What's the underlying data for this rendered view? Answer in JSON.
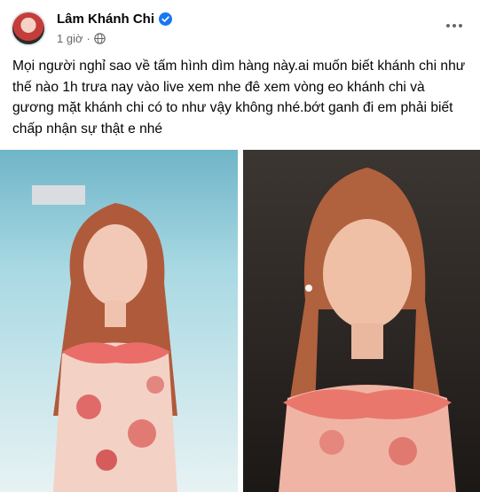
{
  "post": {
    "author_name": "Lâm Khánh Chi",
    "timestamp": "1 giờ",
    "separator": "·",
    "text": "Mọi người nghỉ sao về tấm hình dìm hàng này.ai muốn biết khánh chi như thế nào 1h trưa nay vào live xem nhe đê xem vòng eo khánh chi và gương mặt khánh chi có to như vậy không nhé.bớt ganh đi em phải biết chấp nhận sự thật e nhé"
  },
  "icons": {
    "verified": "verified-badge-icon",
    "privacy": "globe-icon",
    "more": "more-options-icon"
  },
  "colors": {
    "verified_blue": "#1877f2",
    "meta_gray": "#65676b"
  }
}
